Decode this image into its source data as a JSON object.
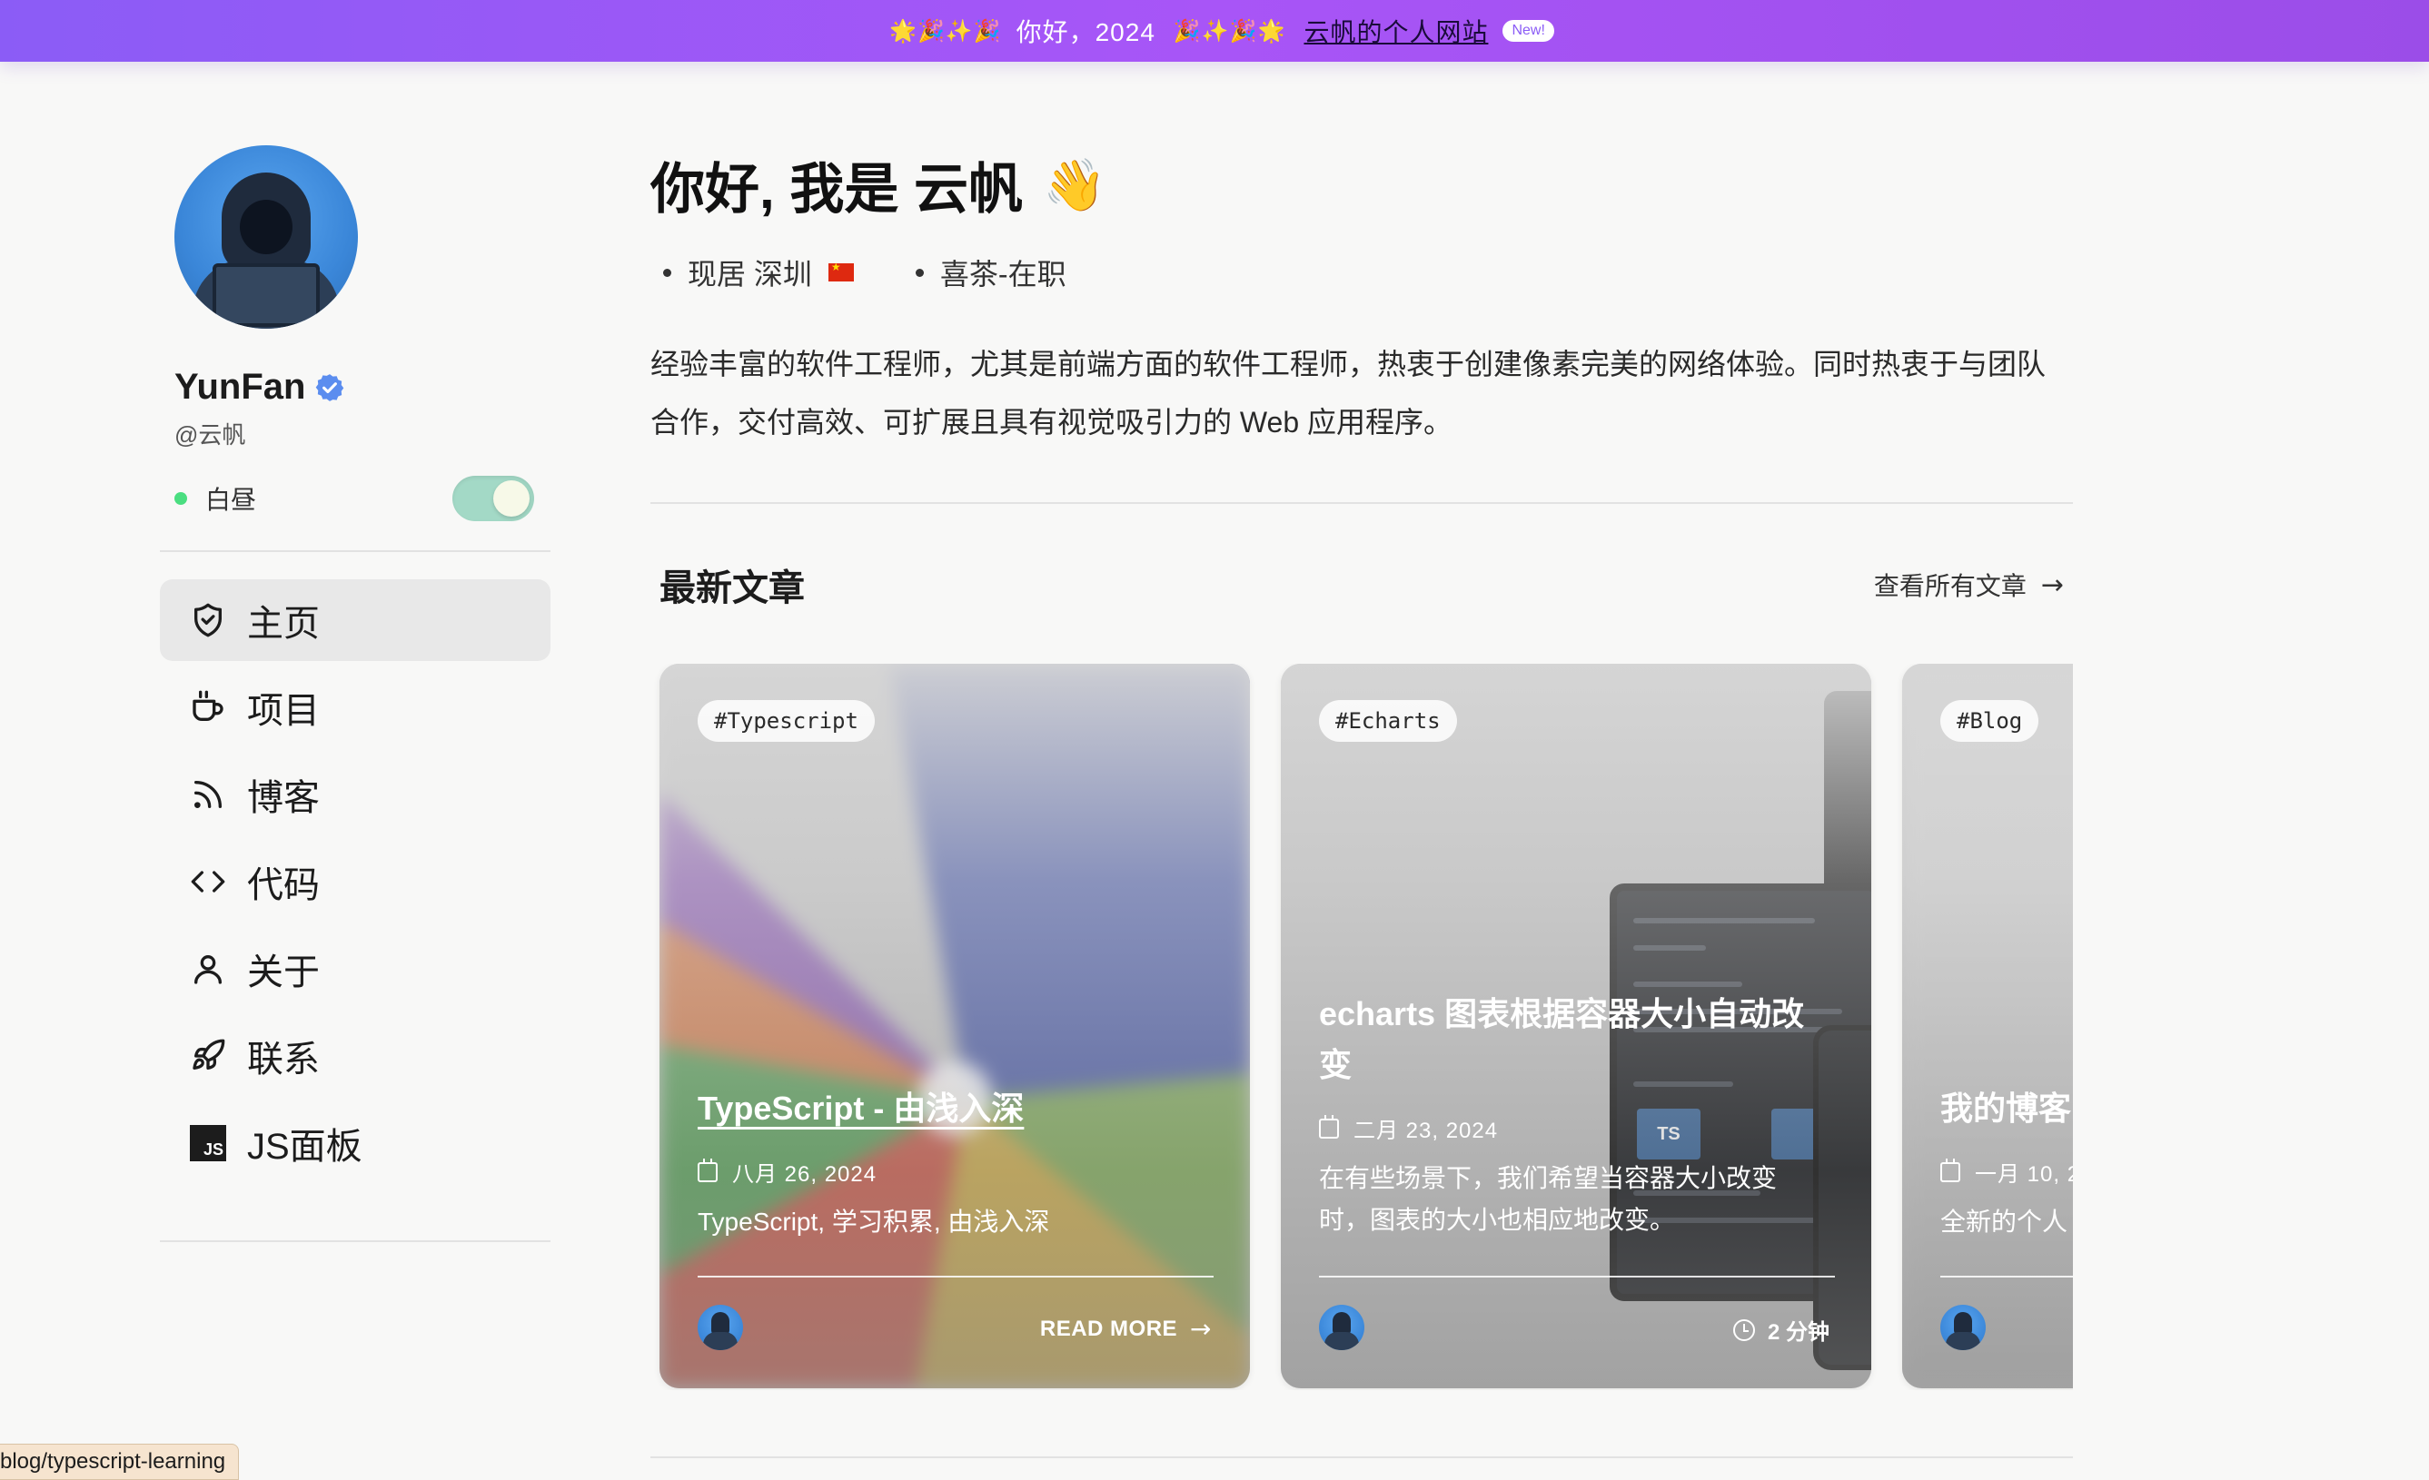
{
  "banner": {
    "emoji_left": "🌟🎉✨🎉",
    "text": "你好，2024",
    "emoji_right": "🎉✨🎉🌟",
    "link": "云帆的个人网站",
    "badge": "New!"
  },
  "profile": {
    "name": "YunFan",
    "handle": "@云帆",
    "theme_label": "白昼",
    "theme_on": true
  },
  "nav": {
    "items": [
      {
        "label": "主页",
        "icon": "shield-check-icon",
        "active": true
      },
      {
        "label": "项目",
        "icon": "coffee-cup-icon"
      },
      {
        "label": "博客",
        "icon": "rss-icon"
      },
      {
        "label": "代码",
        "icon": "code-brackets-icon"
      },
      {
        "label": "关于",
        "icon": "user-icon"
      },
      {
        "label": "联系",
        "icon": "rocket-icon"
      },
      {
        "label": "JS面板",
        "icon": "js-logo-icon",
        "js_text": "JS"
      }
    ]
  },
  "hero": {
    "title": "你好, 我是 云帆",
    "wave": "👋",
    "facts": [
      "现居 深圳",
      "喜茶-在职"
    ],
    "bio": "经验丰富的软件工程师，尤其是前端方面的软件工程师，热衷于创建像素完美的网络体验。同时热衷于与团队合作，交付高效、可扩展且具有视觉吸引力的 Web 应用程序。"
  },
  "articles": {
    "section_title": "最新文章",
    "view_all": "查看所有文章",
    "cards": [
      {
        "tag": "Typescript",
        "title": "TypeScript - 由浅入深",
        "date": "八月 26, 2024",
        "desc": "TypeScript, 学习积累, 由浅入深",
        "action": "READ MORE"
      },
      {
        "tag": "Echarts",
        "title": "echarts 图表根据容器大小自动改变",
        "date": "二月 23, 2024",
        "desc": "在有些场景下，我们希望当容器大小改变时，图表的大小也相应地改变。",
        "read_time": "2 分钟"
      },
      {
        "tag": "Blog",
        "title": "我的博客",
        "date": "一月 10, 2",
        "desc": "全新的个人"
      }
    ]
  },
  "status_bar": {
    "url": "blog/typescript-learning"
  },
  "colors": {
    "banner_gradient_start": "#8b5cf6",
    "banner_gradient_end": "#a855f7",
    "verified": "#5b8def",
    "status_dot": "#4ade80",
    "toggle_track": "#a3d9c6"
  }
}
